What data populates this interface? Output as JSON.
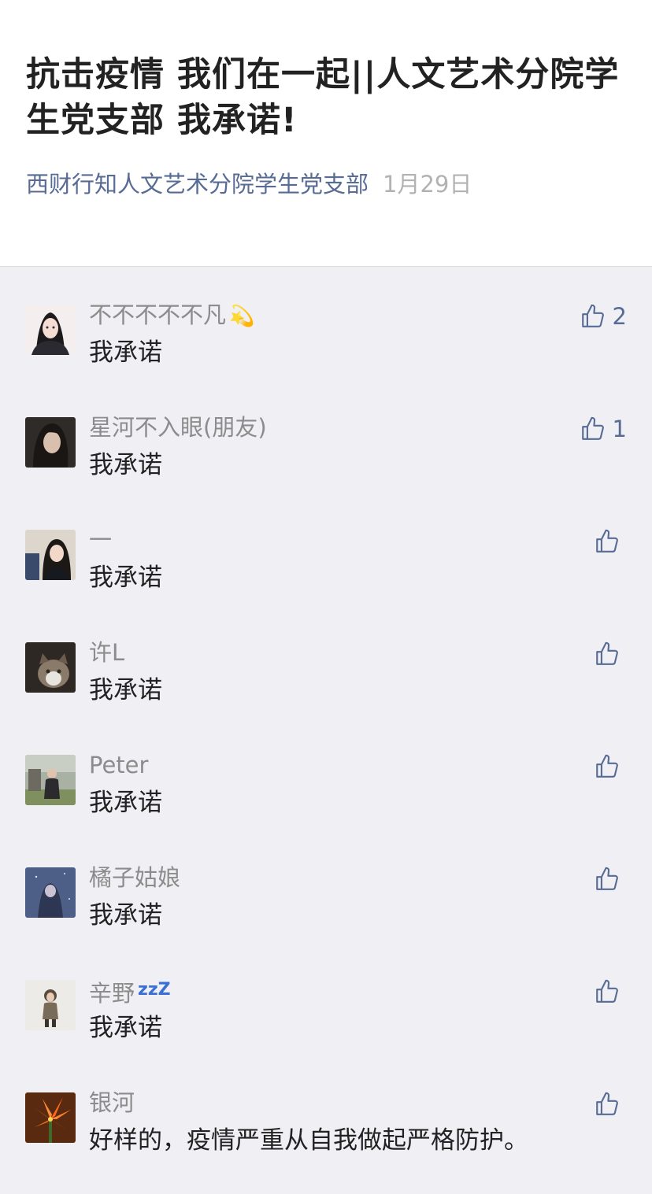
{
  "article": {
    "title": "抗击疫情 我们在一起||人文艺术分院学生党支部 我承诺!",
    "account": "西财行知人文艺术分院学生党支部",
    "date": "1月29日"
  },
  "comments": [
    {
      "nickname": "不不不不不凡",
      "emoji": "💫",
      "text": "我承诺",
      "likes": "2",
      "avatar": "avatar-illustrated-girl"
    },
    {
      "nickname": "星河不入眼(朋友)",
      "text": "我承诺",
      "likes": "1",
      "avatar": "avatar-dark-portrait"
    },
    {
      "nickname": "一",
      "text": "我承诺",
      "likes": "",
      "avatar": "avatar-smiling-girl"
    },
    {
      "nickname": "许L",
      "text": "我承诺",
      "likes": "",
      "avatar": "avatar-cat"
    },
    {
      "nickname": "Peter",
      "text": "我承诺",
      "likes": "",
      "avatar": "avatar-man-outdoors"
    },
    {
      "nickname": "橘子姑娘",
      "text": "我承诺",
      "likes": "",
      "avatar": "avatar-blue-night"
    },
    {
      "nickname": "辛野",
      "suffix": "zzZ",
      "text": "我承诺",
      "likes": "",
      "avatar": "avatar-child-standing"
    },
    {
      "nickname": "银河",
      "text": "好样的，疫情严重从自我做起严格防护。",
      "likes": "",
      "avatar": "avatar-orange-flower"
    }
  ],
  "icons": {
    "like": "thumbs-up-icon"
  },
  "colors": {
    "link": "#576b95",
    "date": "#b2b2b2",
    "nickname": "#8c8c8c",
    "background": "#efeff4"
  }
}
